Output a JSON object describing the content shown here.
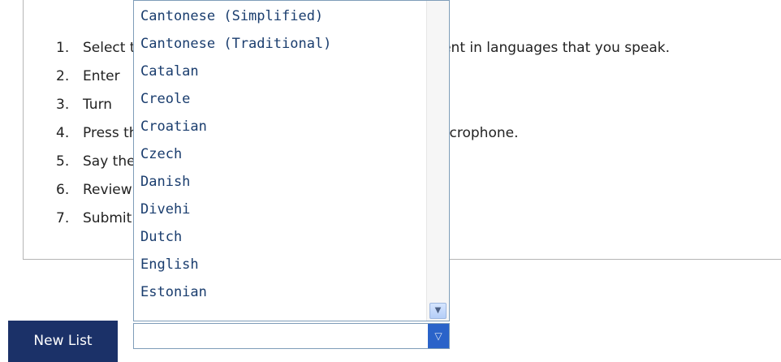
{
  "instructions": {
    "steps": [
      {
        "num": "1.",
        "text": "Select the language of the list. Please only add content in languages that you speak."
      },
      {
        "num": "2.",
        "text": "Enter"
      },
      {
        "num": "3.",
        "text": "Turn"
      },
      {
        "num": "4.",
        "text": "Press the Record button and allow the use of your microphone."
      },
      {
        "num": "5.",
        "text": "Say the words, then press the Stop button."
      },
      {
        "num": "6.",
        "text": "Review"
      },
      {
        "num": "7.",
        "text": "Submit"
      }
    ]
  },
  "buttons": {
    "new_list_label": "New List"
  },
  "language_select": {
    "value": "",
    "options": [
      "Cantonese (Simplified)",
      "Cantonese (Traditional)",
      "Catalan",
      "Creole",
      "Croatian",
      "Czech",
      "Danish",
      "Divehi",
      "Dutch",
      "English",
      "Estonian"
    ]
  },
  "colors": {
    "button_bg": "#1b3168",
    "option_text": "#1a3d6e",
    "select_arrow_bg": "#2a63c9"
  },
  "icons": {
    "scroll_down": "chevron-down-icon",
    "select_arrow": "triangle-down-icon"
  }
}
